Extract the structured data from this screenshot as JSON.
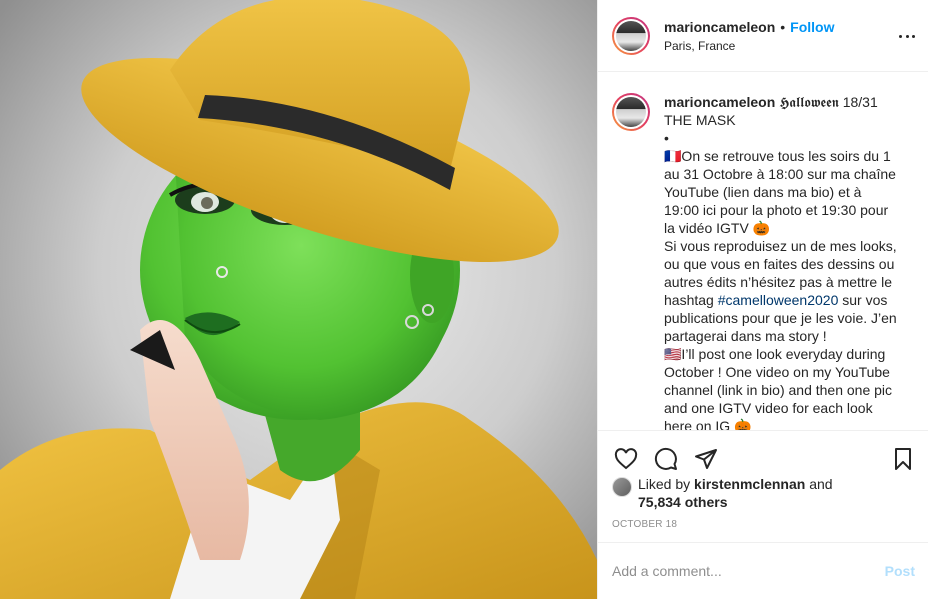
{
  "post": {
    "username": "marioncameleon",
    "follow_label": "Follow",
    "separator": "•",
    "location": "Paris, France",
    "more_icon": "more-horizontal-icon"
  },
  "caption": {
    "username": "marioncameleon",
    "text": "𝕳𝖆𝖑𝖑𝖔𝖜𝖊𝖊𝖓 18/31\nTHE MASK\n•\n🇫🇷On se retrouve tous les soirs du 1 au 31 Octobre à 18:00 sur ma chaîne YouTube (lien dans ma bio) et à 19:00 ici pour la photo et 19:30 pour la vidéo IGTV 🎃\nSi vous reproduisez un de mes looks, ou que vous en faites des dessins ou autres édits n’hésitez pas à mettre le hashtag ",
    "hashtag": "#camelloween2020",
    "text_after": " sur vos publications pour que je les voie. J’en partagerai dans ma story !\n🇺🇸I’ll post one look everyday during October ! One video on my YouTube channel (link in bio) and then one pic and one IGTV video for each look here on IG 🎃"
  },
  "actions": {
    "like_icon": "heart-icon",
    "comment_icon": "comment-icon",
    "share_icon": "share-icon",
    "save_icon": "bookmark-icon"
  },
  "likes": {
    "prefix": "Liked by ",
    "user": "kirstenmclennan",
    "and": " and",
    "others": "75,834 others"
  },
  "date": "OCTOBER 18",
  "comment": {
    "placeholder": "Add a comment...",
    "post_label": "Post"
  },
  "colors": {
    "link_blue": "#0095f6",
    "post_disabled": "#b2dffc",
    "hashtag": "#00376b",
    "skin_green": "#5fc83a",
    "hat_yellow": "#e8b72f"
  }
}
